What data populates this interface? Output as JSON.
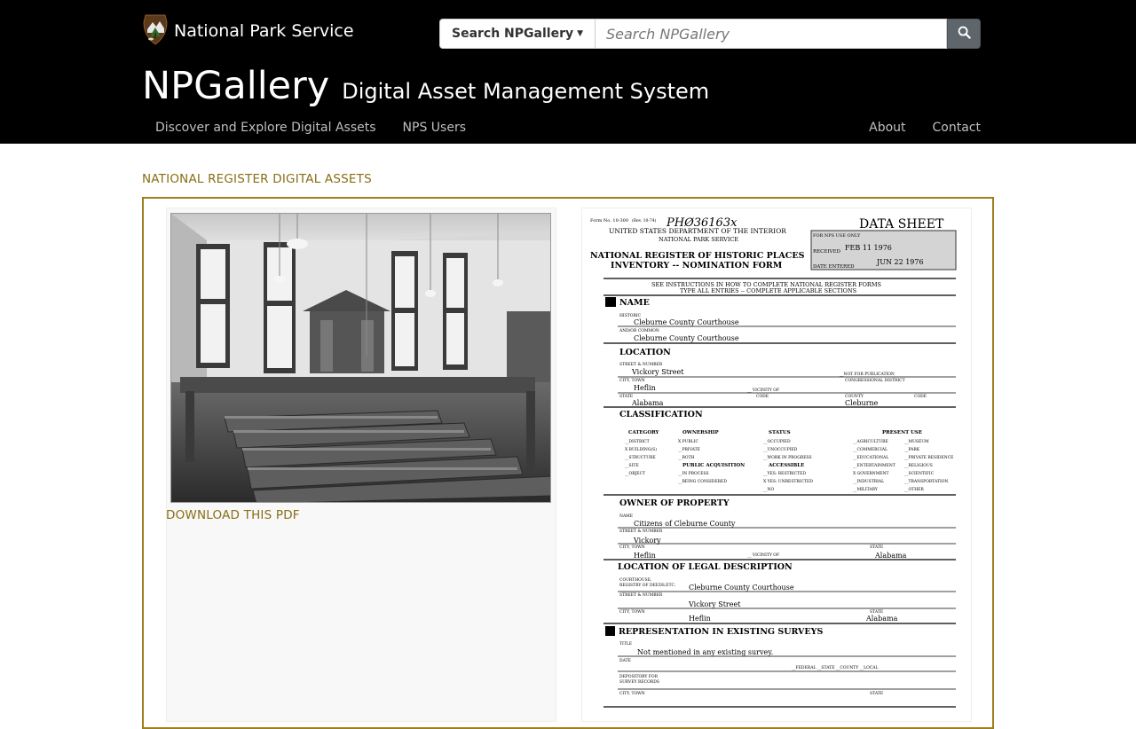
{
  "header": {
    "brand": "National Park Service",
    "search_scope": "Search NPGallery",
    "search_placeholder": "Search NPGallery",
    "title": "NPGallery",
    "subtitle": "Digital Asset Management System",
    "nav_left": [
      "Discover and Explore Digital Assets",
      "NPS Users"
    ],
    "nav_right": [
      "About",
      "Contact"
    ]
  },
  "main": {
    "section_title": "NATIONAL REGISTER DIGITAL ASSETS",
    "download_label": "DOWNLOAD THIS PDF"
  },
  "document": {
    "handwritten_id": "PHØ36163x",
    "data_sheet": "DATA SHEET",
    "form_no": "Form No. 10-300",
    "form_rev": "(Rev. 10-74)",
    "dept": "UNITED STATES DEPARTMENT OF THE INTERIOR",
    "service": "NATIONAL PARK SERVICE",
    "form_title_1": "NATIONAL REGISTER OF HISTORIC PLACES",
    "form_title_2": "INVENTORY -- NOMINATION FORM",
    "nps_use": "FOR NPS USE ONLY",
    "received_label": "RECEIVED",
    "received_date": "FEB 11 1976",
    "entered_label": "DATE ENTERED",
    "entered_date": "JUN 22 1976",
    "instructions_1": "SEE INSTRUCTIONS IN HOW TO COMPLETE NATIONAL REGISTER FORMS",
    "instructions_2": "TYPE ALL ENTRIES -- COMPLETE APPLICABLE SECTIONS",
    "s1": "NAME",
    "historic_label": "HISTORIC",
    "historic_value": "Cleburne County Courthouse",
    "common_label": "AND/OR COMMON",
    "common_value": "Cleburne County Courthouse",
    "s2": "LOCATION",
    "street_label": "STREET & NUMBER",
    "street_value": "Vickory Street",
    "not_pub": "__NOT FOR PUBLICATION",
    "city_label": "CITY, TOWN",
    "city_value": "Heflin",
    "vicinity": "__ VICINITY OF",
    "cong_label": "CONGRESSIONAL DISTRICT",
    "state_label": "STATE",
    "state_value": "Alabama",
    "code_label": "CODE",
    "county_label": "COUNTY",
    "county_value": "Cleburne",
    "s3": "CLASSIFICATION",
    "cat_h": "CATEGORY",
    "own_h": "OWNERSHIP",
    "status_h": "STATUS",
    "use_h": "PRESENT USE",
    "cat_items": [
      "__DISTRICT",
      "X BUILDING(S)",
      "__STRUCTURE",
      "__SITE",
      "__OBJECT"
    ],
    "own_items": [
      "X PUBLIC",
      "__PRIVATE",
      "__BOTH"
    ],
    "pa_h": "PUBLIC ACQUISITION",
    "pa_items": [
      "__IN PROCESS",
      "__BEING CONSIDERED"
    ],
    "status_items": [
      "__OCCUPIED",
      "__UNOCCUPIED",
      "__WORK IN PROGRESS"
    ],
    "acc_h": "ACCESSIBLE",
    "acc_items": [
      "__YES: RESTRICTED",
      "X YES: UNRESTRICTED",
      "__NO"
    ],
    "use_items_1": [
      "__AGRICULTURE",
      "__COMMERCIAL",
      "__EDUCATIONAL",
      "__ENTERTAINMENT",
      "X GOVERNMENT",
      "__INDUSTRIAL",
      "__MILITARY"
    ],
    "use_items_2": [
      "__MUSEUM",
      "__PARK",
      "__PRIVATE RESIDENCE",
      "__RELIGIOUS",
      "__SCIENTIFIC",
      "__TRANSPORTATION",
      "__OTHER"
    ],
    "s4": "OWNER OF PROPERTY",
    "name_label": "NAME",
    "owner_name": "Citizens of Cleburne County",
    "owner_street": "Vickory",
    "owner_city": "Heflin",
    "owner_state": "Alabama",
    "s5": "LOCATION OF LEGAL DESCRIPTION",
    "courthouse_label_1": "COURTHOUSE,",
    "courthouse_label_2": "REGISTRY OF DEEDS,ETC.",
    "courthouse_value": "Cleburne County Courthouse",
    "legal_street": "Vickory Street",
    "legal_city": "Heflin",
    "legal_state": "Alabama",
    "s6": "REPRESENTATION IN EXISTING SURVEYS",
    "title_label": "TITLE",
    "survey_title": "Not mentioned in any existing survey.",
    "date_label": "DATE",
    "survey_levels": "__FEDERAL  __STATE  __COUNTY  __LOCAL",
    "depository_1": "DEPOSITORY FOR",
    "depository_2": "SURVEY RECORDS"
  },
  "icons": {
    "logo": "nps-arrowhead-logo",
    "search": "search-icon",
    "caret": "caret-down-icon"
  },
  "colors": {
    "header_bg": "#000000",
    "accent": "#a17d1e",
    "link": "#8a6d15",
    "search_btn": "#5e666b"
  }
}
